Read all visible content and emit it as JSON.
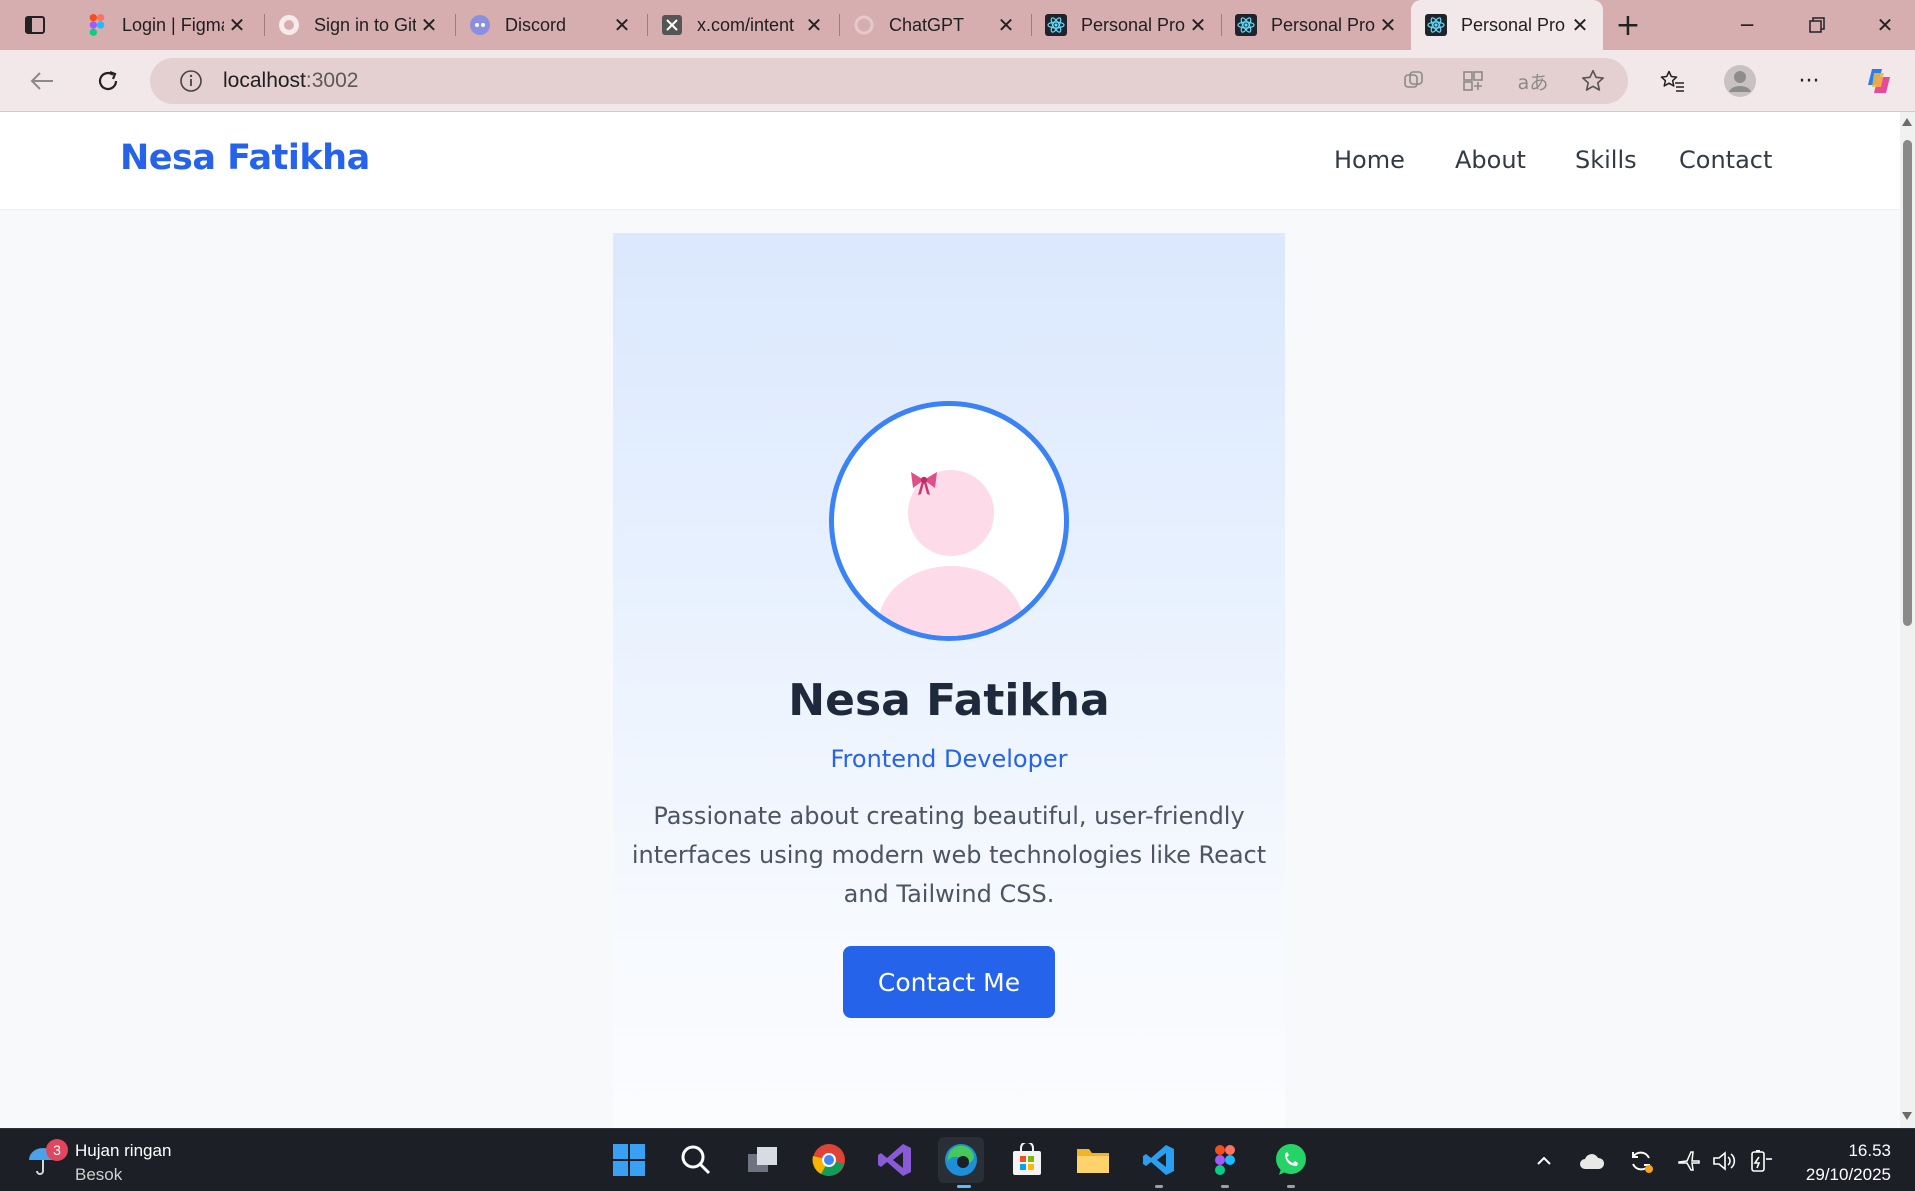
{
  "browser": {
    "tabs": [
      {
        "title": "Login | Figma",
        "icon": "figma-icon"
      },
      {
        "title": "Sign in to GitHub",
        "icon": "github-icon"
      },
      {
        "title": "Discord",
        "icon": "discord-icon"
      },
      {
        "title": "x.com/intent",
        "icon": "x-icon"
      },
      {
        "title": "ChatGPT",
        "icon": "chatgpt-icon"
      },
      {
        "title": "Personal Pro",
        "icon": "react-icon"
      },
      {
        "title": "Personal Pro",
        "icon": "react-icon"
      },
      {
        "title": "Personal Pro",
        "icon": "react-icon"
      }
    ],
    "active_tab": 7,
    "address": {
      "host": "localhost",
      "port": ":3002"
    }
  },
  "page": {
    "brand": "Nesa Fatikha",
    "nav": [
      "Home",
      "About",
      "Skills",
      "Contact"
    ],
    "hero": {
      "name": "Nesa Fatikha",
      "role": "Frontend Developer",
      "description": "Passionate about creating beautiful, user-friendly interfaces using modern web technologies like React and Tailwind CSS.",
      "cta": "Contact Me"
    }
  },
  "taskbar": {
    "weather": {
      "title": "Hujan ringan",
      "subtitle": "Besok",
      "badge": "3"
    },
    "clock": {
      "time": "16.53",
      "date": "29/10/2025"
    }
  },
  "colors": {
    "accent": "#2563eb",
    "avatar_ring": "#3b82f6",
    "avatar_fill": "#fddbe8",
    "tabstrip": "#d7aeb0"
  }
}
